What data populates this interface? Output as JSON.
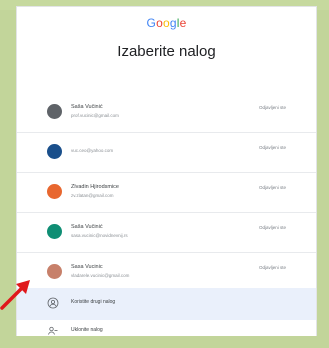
{
  "logo": {
    "letters": [
      {
        "ch": "G",
        "color": "#4285f4"
      },
      {
        "ch": "o",
        "color": "#ea4335"
      },
      {
        "ch": "o",
        "color": "#fbbc05"
      },
      {
        "ch": "g",
        "color": "#4285f4"
      },
      {
        "ch": "l",
        "color": "#34a853"
      },
      {
        "ch": "e",
        "color": "#ea4335"
      }
    ]
  },
  "title": "Izaberite nalog",
  "accounts": [
    {
      "name": "Saša Vučinić",
      "email": "prof.vucinic@gmail.com",
      "status": "Odjavljeni ste",
      "avatar_color": "#5f6368"
    },
    {
      "name": "",
      "email": "vuc.ceo@yahoo.com",
      "status": "Odjavljeni ste",
      "avatar_color": "#1a4f8b"
    },
    {
      "name": "Zlvadin Hjirodsmice",
      "email": "zv.zlatan@gmail.com",
      "status": "Odjavljeni ste",
      "avatar_color": "#e8672f"
    },
    {
      "name": "Saša Vučinić",
      "email": "sasa.vucinic@novidnevnij.rs",
      "status": "Odjavljeni ste",
      "avatar_color": "#0f8e74"
    },
    {
      "name": "Sasa Vucinic",
      "email": "vladarele.vucinic@gmail.com",
      "status": "Odjavljeni ste",
      "avatar_color": "#c7806a"
    }
  ],
  "use_other": {
    "label": "Koristite drugi nalog",
    "icon": "person-circle-icon"
  },
  "remove": {
    "label": "Uklonite nalog",
    "icon": "person-remove-icon"
  },
  "annotation": {
    "color": "#e0181b",
    "icon": "red-arrow"
  }
}
